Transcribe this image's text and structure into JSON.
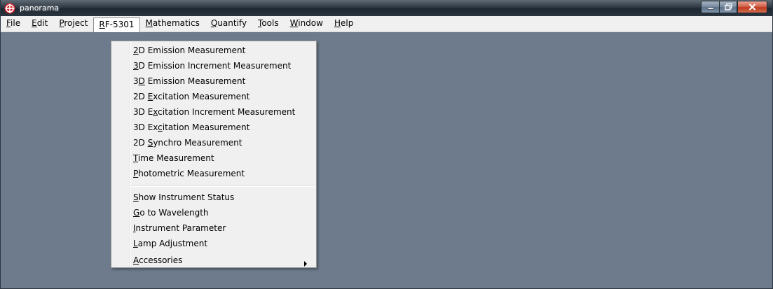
{
  "window": {
    "title": "panorama",
    "background_color": "#6d7b8c"
  },
  "title_bar": {
    "app_icon": "panorama-logo-icon",
    "icon_color": "#d4242c",
    "buttons": [
      {
        "name": "minimize",
        "icon": "minimize-icon"
      },
      {
        "name": "maximize",
        "icon": "restore-icon"
      },
      {
        "name": "close",
        "icon": "close-icon"
      }
    ]
  },
  "menubar": {
    "items": [
      {
        "label_pre": "",
        "mnemonic": "F",
        "label_post": "ile"
      },
      {
        "label_pre": "",
        "mnemonic": "E",
        "label_post": "dit"
      },
      {
        "label_pre": "",
        "mnemonic": "P",
        "label_post": "roject"
      },
      {
        "label_pre": "",
        "mnemonic": "R",
        "label_post": "F-5301"
      },
      {
        "label_pre": "",
        "mnemonic": "M",
        "label_post": "athematics"
      },
      {
        "label_pre": "",
        "mnemonic": "Q",
        "label_post": "uantify"
      },
      {
        "label_pre": "",
        "mnemonic": "T",
        "label_post": "ools"
      },
      {
        "label_pre": "",
        "mnemonic": "W",
        "label_post": "indow"
      },
      {
        "label_pre": "",
        "mnemonic": "H",
        "label_post": "elp"
      }
    ],
    "active_index": 3
  },
  "dropdown": {
    "items": [
      {
        "pre": "",
        "mnemonic": "2",
        "post": "D Emission Measurement"
      },
      {
        "pre": "",
        "mnemonic": "3",
        "post": "D Emission Increment Measurement"
      },
      {
        "pre": "3",
        "mnemonic": "D",
        "post": " Emission Measurement"
      },
      {
        "pre": "2D ",
        "mnemonic": "E",
        "post": "xcitation Measurement"
      },
      {
        "pre": "3D E",
        "mnemonic": "x",
        "post": "citation Increment Measurement"
      },
      {
        "pre": "3D Ex",
        "mnemonic": "c",
        "post": "itation Measurement"
      },
      {
        "pre": "2D ",
        "mnemonic": "S",
        "post": "ynchro Measurement"
      },
      {
        "pre": "",
        "mnemonic": "T",
        "post": "ime Measurement"
      },
      {
        "pre": "",
        "mnemonic": "P",
        "post": "hotometric Measurement"
      },
      {
        "pre": "",
        "mnemonic": "S",
        "post": "how Instrument Status"
      },
      {
        "pre": "",
        "mnemonic": "G",
        "post": "o to Wavelength"
      },
      {
        "pre": "",
        "mnemonic": "I",
        "post": "nstrument Parameter"
      },
      {
        "pre": "",
        "mnemonic": "L",
        "post": "amp Adjustment"
      },
      {
        "pre": "",
        "mnemonic": "A",
        "post": "ccessories",
        "submenu_icon": "submenu-arrow-icon"
      }
    ]
  }
}
